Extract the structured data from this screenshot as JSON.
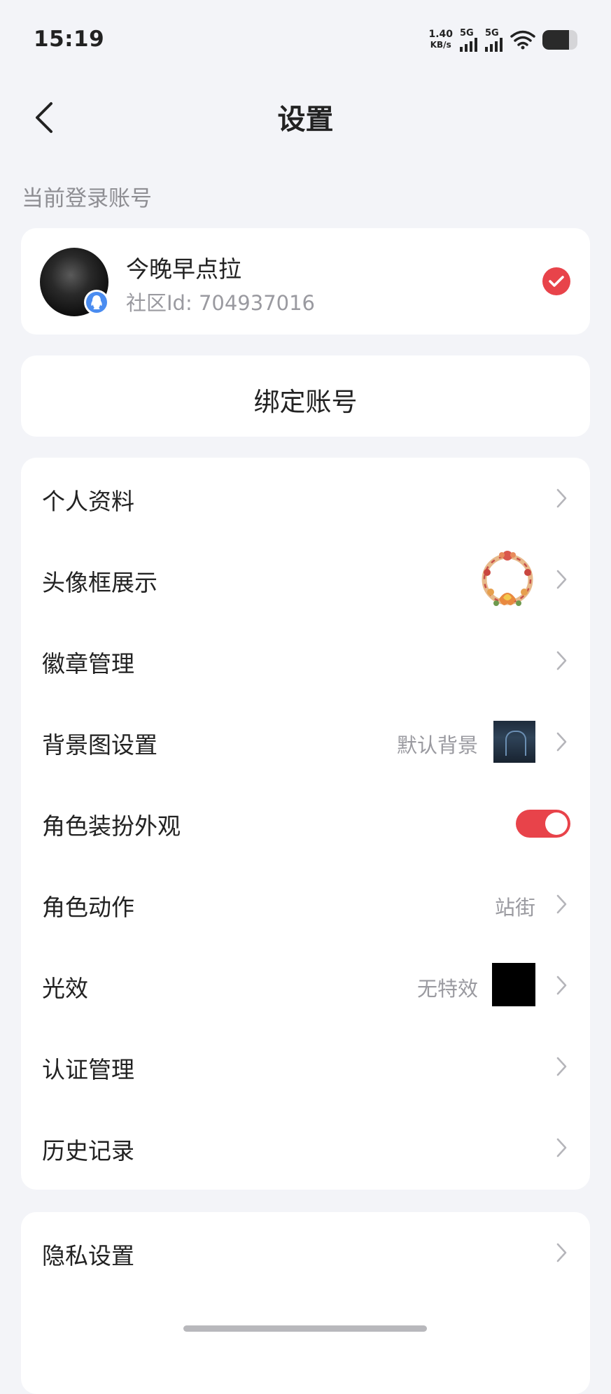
{
  "status_bar": {
    "time": "15:19",
    "net_speed_value": "1.40",
    "net_speed_unit": "KB/s",
    "sim1_label": "5G",
    "sim2_label": "5G",
    "battery_level": 0.75
  },
  "header": {
    "title": "设置"
  },
  "account_section": {
    "label": "当前登录账号",
    "name": "今晚早点拉",
    "community_id": "社区Id: 704937016"
  },
  "bind_button": {
    "label": "绑定账号"
  },
  "menu": {
    "items": [
      {
        "label": "个人资料"
      },
      {
        "label": "头像框展示"
      },
      {
        "label": "徽章管理"
      },
      {
        "label": "背景图设置",
        "value": "默认背景"
      },
      {
        "label": "角色装扮外观",
        "toggle_on": true
      },
      {
        "label": "角色动作",
        "value": "站街"
      },
      {
        "label": "光效",
        "value": "无特效"
      },
      {
        "label": "认证管理"
      },
      {
        "label": "历史记录"
      }
    ]
  },
  "menu2": {
    "items": [
      {
        "label": "隐私设置"
      }
    ]
  },
  "colors": {
    "accent": "#e8434a",
    "page_bg": "#f3f4f8",
    "card_bg": "#ffffff",
    "secondary_text": "#9a9aa0"
  }
}
